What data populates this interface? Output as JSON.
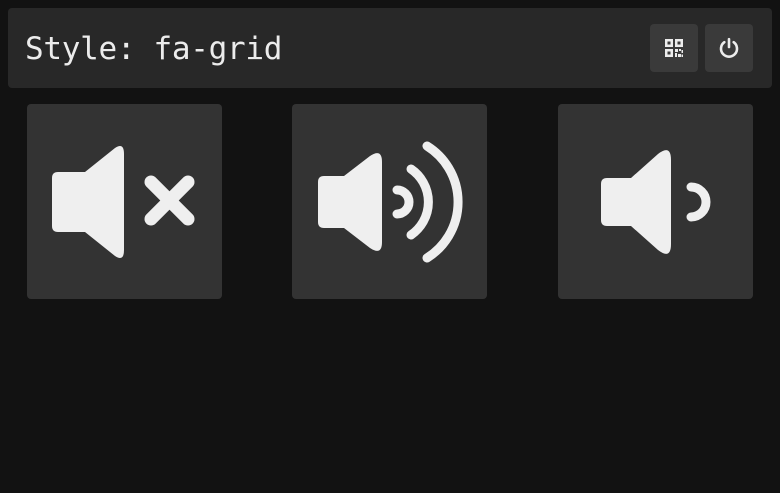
{
  "header": {
    "title": "Style: fa-grid",
    "buttons": [
      {
        "icon": "qr-code-icon"
      },
      {
        "icon": "power-icon"
      }
    ]
  },
  "tiles": [
    {
      "icon": "volume-mute-icon"
    },
    {
      "icon": "volume-up-icon"
    },
    {
      "icon": "volume-down-icon"
    }
  ],
  "colors": {
    "background": "#121212",
    "header": "#282828",
    "button": "#3a3a3a",
    "tile": "#333333",
    "icon": "#ececec"
  }
}
